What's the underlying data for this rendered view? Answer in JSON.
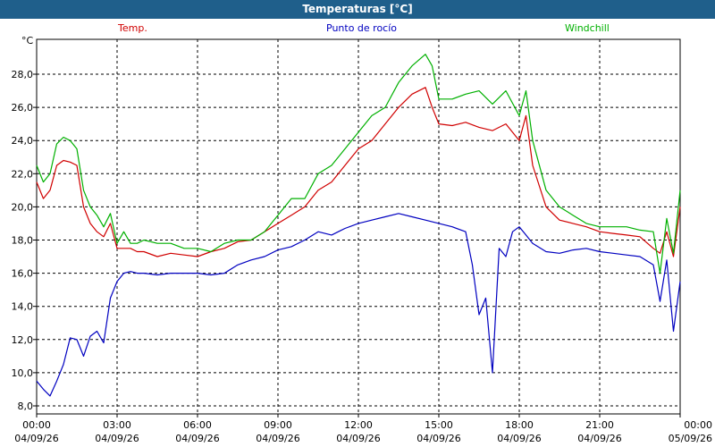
{
  "title": "Temperaturas [°C]",
  "unit": "°C",
  "colors": {
    "titlebar": "#1f5f8b",
    "temp": "#d00000",
    "dew": "#0000c0",
    "windchill": "#00b000"
  },
  "chart_data": {
    "type": "line",
    "title": "Temperaturas [°C]",
    "ylabel": "°C",
    "ylim": [
      8,
      29.5
    ],
    "xlim_hours": [
      0,
      24
    ],
    "grid": true,
    "legend_placement": "top",
    "y_ticks": [
      "8,0",
      "10,0",
      "12,0",
      "14,0",
      "16,0",
      "18,0",
      "20,0",
      "22,0",
      "24,0",
      "26,0",
      "28,0"
    ],
    "x_ticks": [
      {
        "time": "00:00",
        "date": "04/09/26"
      },
      {
        "time": "03:00",
        "date": "04/09/26"
      },
      {
        "time": "06:00",
        "date": "04/09/26"
      },
      {
        "time": "09:00",
        "date": "04/09/26"
      },
      {
        "time": "12:00",
        "date": "04/09/26"
      },
      {
        "time": "15:00",
        "date": "04/09/26"
      },
      {
        "time": "18:00",
        "date": "04/09/26"
      },
      {
        "time": "21:00",
        "date": "04/09/26"
      },
      {
        "time": "00:00",
        "date": "05/09/26"
      }
    ],
    "series": [
      {
        "name": "Temp.",
        "color": "#d00000",
        "x": [
          0,
          0.25,
          0.5,
          0.75,
          1.0,
          1.25,
          1.5,
          1.75,
          2.0,
          2.25,
          2.5,
          2.75,
          3.0,
          3.25,
          3.5,
          3.75,
          4.0,
          4.5,
          5.0,
          5.5,
          6.0,
          6.5,
          7.0,
          7.5,
          8.0,
          8.5,
          9.0,
          9.5,
          10.0,
          10.5,
          11.0,
          11.5,
          12.0,
          12.5,
          13.0,
          13.5,
          14.0,
          14.5,
          14.75,
          15.0,
          15.5,
          16.0,
          16.5,
          17.0,
          17.5,
          18.0,
          18.25,
          18.5,
          19.0,
          19.5,
          20.0,
          20.5,
          21.0,
          21.5,
          22.0,
          22.5,
          23.0,
          23.25,
          23.5,
          23.75,
          24.0
        ],
        "values": [
          21.5,
          20.5,
          21.0,
          22.5,
          22.8,
          22.7,
          22.5,
          20.0,
          19.0,
          18.5,
          18.2,
          19.0,
          17.5,
          17.5,
          17.5,
          17.3,
          17.3,
          17.0,
          17.2,
          17.1,
          17.0,
          17.3,
          17.5,
          17.9,
          18.0,
          18.5,
          19.0,
          19.5,
          20.0,
          21.0,
          21.5,
          22.5,
          23.5,
          24.0,
          25.0,
          26.0,
          26.8,
          27.2,
          26.0,
          25.0,
          24.9,
          25.1,
          24.8,
          24.6,
          25.0,
          24.0,
          25.5,
          22.5,
          20.0,
          19.2,
          19.0,
          18.8,
          18.5,
          18.4,
          18.3,
          18.2,
          17.5,
          17.2,
          18.5,
          17.0,
          20.0
        ]
      },
      {
        "name": "Punto de rocío",
        "color": "#0000c0",
        "x": [
          0,
          0.25,
          0.5,
          0.75,
          1.0,
          1.25,
          1.5,
          1.75,
          2.0,
          2.25,
          2.5,
          2.75,
          3.0,
          3.25,
          3.5,
          3.75,
          4.0,
          4.5,
          5.0,
          5.5,
          6.0,
          6.5,
          7.0,
          7.5,
          8.0,
          8.5,
          9.0,
          9.5,
          10.0,
          10.5,
          11.0,
          11.5,
          12.0,
          12.5,
          13.0,
          13.5,
          14.0,
          14.5,
          15.0,
          15.5,
          16.0,
          16.25,
          16.5,
          16.75,
          17.0,
          17.25,
          17.5,
          17.75,
          18.0,
          18.25,
          18.5,
          19.0,
          19.5,
          20.0,
          20.5,
          21.0,
          21.5,
          22.0,
          22.5,
          23.0,
          23.25,
          23.5,
          23.75,
          24.0
        ],
        "values": [
          9.5,
          9.0,
          8.6,
          9.5,
          10.5,
          12.1,
          12.0,
          11.0,
          12.2,
          12.5,
          11.8,
          14.5,
          15.5,
          16.0,
          16.1,
          16.0,
          16.0,
          15.9,
          16.0,
          16.0,
          16.0,
          15.9,
          16.0,
          16.5,
          16.8,
          17.0,
          17.4,
          17.6,
          18.0,
          18.5,
          18.3,
          18.7,
          19.0,
          19.2,
          19.4,
          19.6,
          19.4,
          19.2,
          19.0,
          18.8,
          18.5,
          16.5,
          13.5,
          14.5,
          10.0,
          17.5,
          17.0,
          18.5,
          18.8,
          18.3,
          17.8,
          17.3,
          17.2,
          17.4,
          17.5,
          17.3,
          17.2,
          17.1,
          17.0,
          16.5,
          14.3,
          16.8,
          12.5,
          15.5
        ]
      },
      {
        "name": "Windchill",
        "color": "#00b000",
        "x": [
          0,
          0.25,
          0.5,
          0.75,
          1.0,
          1.25,
          1.5,
          1.75,
          2.0,
          2.25,
          2.5,
          2.75,
          3.0,
          3.25,
          3.5,
          3.75,
          4.0,
          4.5,
          5.0,
          5.5,
          6.0,
          6.5,
          7.0,
          7.5,
          8.0,
          8.5,
          9.0,
          9.5,
          10.0,
          10.5,
          11.0,
          11.5,
          12.0,
          12.5,
          13.0,
          13.5,
          14.0,
          14.5,
          14.75,
          15.0,
          15.5,
          16.0,
          16.5,
          17.0,
          17.5,
          18.0,
          18.25,
          18.5,
          19.0,
          19.5,
          20.0,
          20.5,
          21.0,
          21.5,
          22.0,
          22.5,
          23.0,
          23.25,
          23.5,
          23.75,
          24.0
        ],
        "values": [
          22.5,
          21.5,
          22.0,
          23.8,
          24.2,
          24.0,
          23.5,
          21.0,
          20.0,
          19.5,
          18.8,
          19.6,
          17.8,
          18.5,
          17.8,
          17.8,
          18.0,
          17.8,
          17.8,
          17.5,
          17.5,
          17.3,
          17.8,
          18.0,
          18.0,
          18.5,
          19.5,
          20.5,
          20.5,
          22.0,
          22.5,
          23.5,
          24.5,
          25.5,
          26.0,
          27.5,
          28.5,
          29.2,
          28.5,
          26.5,
          26.5,
          26.8,
          27.0,
          26.2,
          27.0,
          25.5,
          27.0,
          24.0,
          21.0,
          20.0,
          19.5,
          19.0,
          18.8,
          18.8,
          18.8,
          18.6,
          18.5,
          16.0,
          19.3,
          17.2,
          21.0
        ]
      }
    ]
  }
}
